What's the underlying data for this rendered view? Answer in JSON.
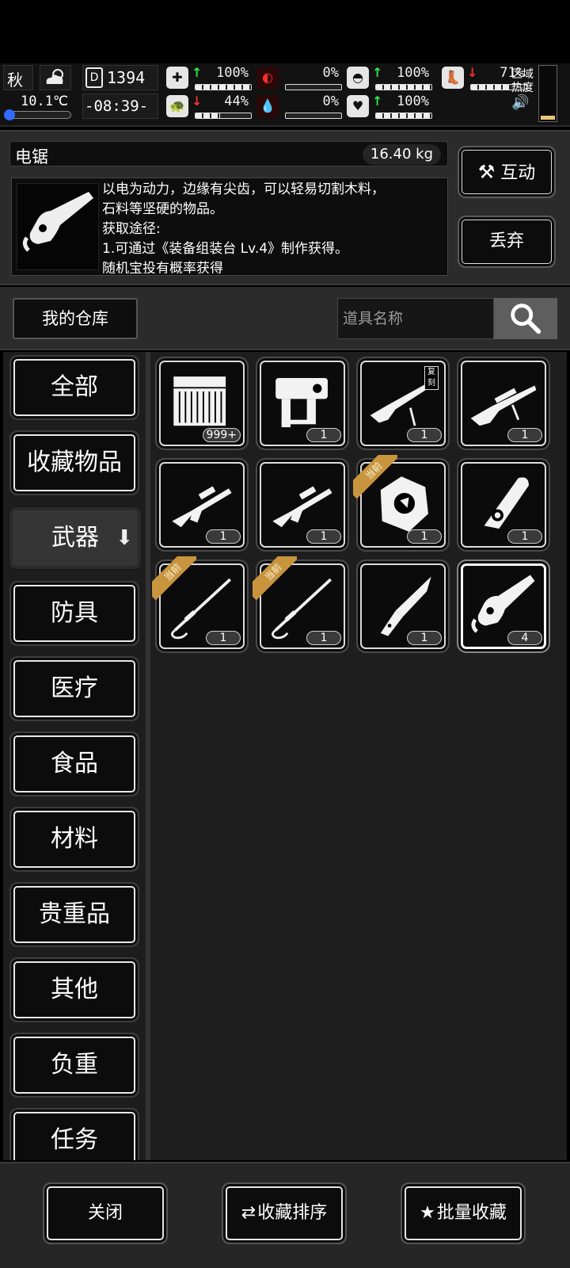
{
  "hud": {
    "season": "秋",
    "temperature": "10.1℃",
    "day": "1394",
    "time": "-08:39-",
    "stats": [
      {
        "name": "health",
        "icon": "medkit-icon",
        "value": "100%",
        "trend": "up",
        "fill": 1.0
      },
      {
        "name": "stamina",
        "icon": "turtle-icon",
        "value": "44%",
        "trend": "down",
        "fill": 0.44
      },
      {
        "name": "hunger",
        "icon": "stomach-icon",
        "value": "0%",
        "trend": "none",
        "fill": 0.0
      },
      {
        "name": "thirst",
        "icon": "water-drop-icon",
        "value": "0%",
        "trend": "none",
        "fill": 0.0
      },
      {
        "name": "armor",
        "icon": "helmet-icon",
        "value": "100%",
        "trend": "up",
        "fill": 1.0
      },
      {
        "name": "mood",
        "icon": "heart-icon",
        "value": "100%",
        "trend": "up",
        "fill": 1.0
      },
      {
        "name": "leg",
        "icon": "boot-icon",
        "value": "71%",
        "trend": "down",
        "fill": 0.71
      }
    ],
    "zone_heat_label": "区域\n热度"
  },
  "item_detail": {
    "name": "电锯",
    "weight": "16.40 kg",
    "description_lines": [
      "以电为动力，边缘有尖齿，可以轻易切割木料，",
      "石料等坚硬的物品。",
      "获取途径:",
      "1.可通过《装备组装台 Lv.4》制作获得。",
      "随机宝投有概率获得"
    ],
    "interact_label": "互动",
    "discard_label": "丢弃"
  },
  "storage": {
    "title": "我的仓库",
    "search_placeholder": "道具名称"
  },
  "categories": [
    {
      "label": "全部",
      "active": false
    },
    {
      "label": "收藏物品",
      "active": false
    },
    {
      "label": "武器",
      "active": true
    },
    {
      "label": "防具",
      "active": false
    },
    {
      "label": "医疗",
      "active": false
    },
    {
      "label": "食品",
      "active": false
    },
    {
      "label": "材料",
      "active": false
    },
    {
      "label": "贵重品",
      "active": false
    },
    {
      "label": "其他",
      "active": false
    },
    {
      "label": "负重",
      "active": false
    },
    {
      "label": "任务",
      "active": false
    }
  ],
  "items": [
    {
      "name": "ammo-crate",
      "count": "999+",
      "current": false,
      "copy": false
    },
    {
      "name": "nail-gun",
      "count": "1",
      "current": false,
      "copy": false
    },
    {
      "name": "sniper-rifle-replica",
      "count": "1",
      "current": false,
      "copy": true
    },
    {
      "name": "sniper-rifle",
      "count": "1",
      "current": false,
      "copy": false
    },
    {
      "name": "assault-rifle-a",
      "count": "1",
      "current": false,
      "copy": false
    },
    {
      "name": "assault-rifle-b",
      "count": "1",
      "current": false,
      "copy": false
    },
    {
      "name": "shield",
      "count": "1",
      "current": true,
      "copy": false
    },
    {
      "name": "mechanical-blade",
      "count": "1",
      "current": false,
      "copy": false
    },
    {
      "name": "katana-a",
      "count": "1",
      "current": true,
      "copy": false
    },
    {
      "name": "katana-b",
      "count": "1",
      "current": true,
      "copy": false
    },
    {
      "name": "knife",
      "count": "1",
      "current": false,
      "copy": false
    },
    {
      "name": "chainsaw",
      "count": "4",
      "current": false,
      "copy": false,
      "selected": true
    }
  ],
  "labels": {
    "current_tag": "当前",
    "copy_tag": "复刻"
  },
  "bottom": {
    "close_label": "关闭",
    "sort_fav_label": "收藏排序",
    "batch_fav_label": "批量收藏"
  }
}
